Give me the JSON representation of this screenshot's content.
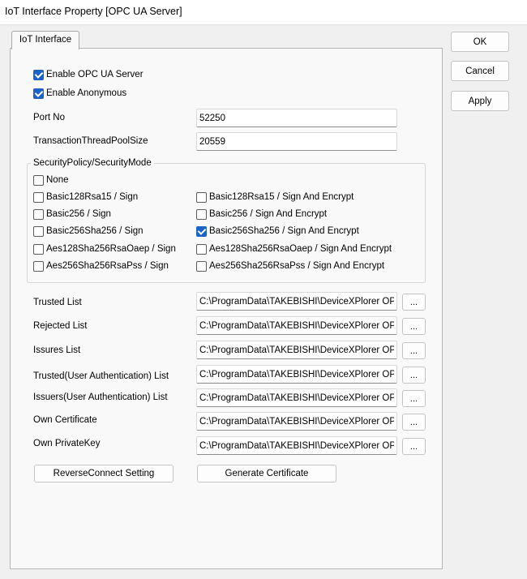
{
  "window": {
    "title": "IoT Interface Property [OPC UA Server]"
  },
  "tab": {
    "label": "IoT Interface"
  },
  "dialog_buttons": {
    "ok": "OK",
    "cancel": "Cancel",
    "apply": "Apply"
  },
  "enable_server": {
    "label": "Enable OPC UA Server",
    "checked": true
  },
  "enable_anonymous": {
    "label": "Enable Anonymous",
    "checked": true
  },
  "port": {
    "label": "Port No",
    "value": "52250"
  },
  "thread_pool": {
    "label": "TransactionThreadPoolSize",
    "value": "20559"
  },
  "security": {
    "title": "SecurityPolicy/SecurityMode",
    "none": {
      "label": "None",
      "checked": false
    },
    "options": [
      {
        "label": "Basic128Rsa15 / Sign",
        "checked": false
      },
      {
        "label": "Basic128Rsa15 / Sign And Encrypt",
        "checked": false
      },
      {
        "label": "Basic256 / Sign",
        "checked": false
      },
      {
        "label": "Basic256 / Sign And Encrypt",
        "checked": false
      },
      {
        "label": "Basic256Sha256 / Sign",
        "checked": false
      },
      {
        "label": "Basic256Sha256 / Sign And Encrypt",
        "checked": true
      },
      {
        "label": "Aes128Sha256RsaOaep / Sign",
        "checked": false
      },
      {
        "label": "Aes128Sha256RsaOaep / Sign And Encrypt",
        "checked": false
      },
      {
        "label": "Aes256Sha256RsaPss / Sign",
        "checked": false
      },
      {
        "label": "Aes256Sha256RsaPss / Sign And Encrypt",
        "checked": false
      }
    ]
  },
  "paths": [
    {
      "label": "Trusted List",
      "value": "C:\\ProgramData\\TAKEBISHI\\DeviceXPlorer OPC Server",
      "browse": "..."
    },
    {
      "label": "Rejected List",
      "value": "C:\\ProgramData\\TAKEBISHI\\DeviceXPlorer OPC Server",
      "browse": "..."
    },
    {
      "label": "Issures List",
      "value": "C:\\ProgramData\\TAKEBISHI\\DeviceXPlorer OPC Server",
      "browse": "..."
    },
    {
      "label": "Trusted(User Authentication) List",
      "value": "C:\\ProgramData\\TAKEBISHI\\DeviceXPlorer OPC Server",
      "browse": "..."
    },
    {
      "label": "Issuers(User Authentication) List",
      "value": "C:\\ProgramData\\TAKEBISHI\\DeviceXPlorer OPC Server",
      "browse": "..."
    },
    {
      "label": "Own Certificate",
      "value": "C:\\ProgramData\\TAKEBISHI\\DeviceXPlorer OPC Server",
      "browse": "..."
    },
    {
      "label": "Own PrivateKey",
      "value": "C:\\ProgramData\\TAKEBISHI\\DeviceXPlorer OPC Server",
      "browse": "..."
    }
  ],
  "actions": {
    "reverse_connect": "ReverseConnect Setting",
    "generate_certificate": "Generate Certificate"
  }
}
